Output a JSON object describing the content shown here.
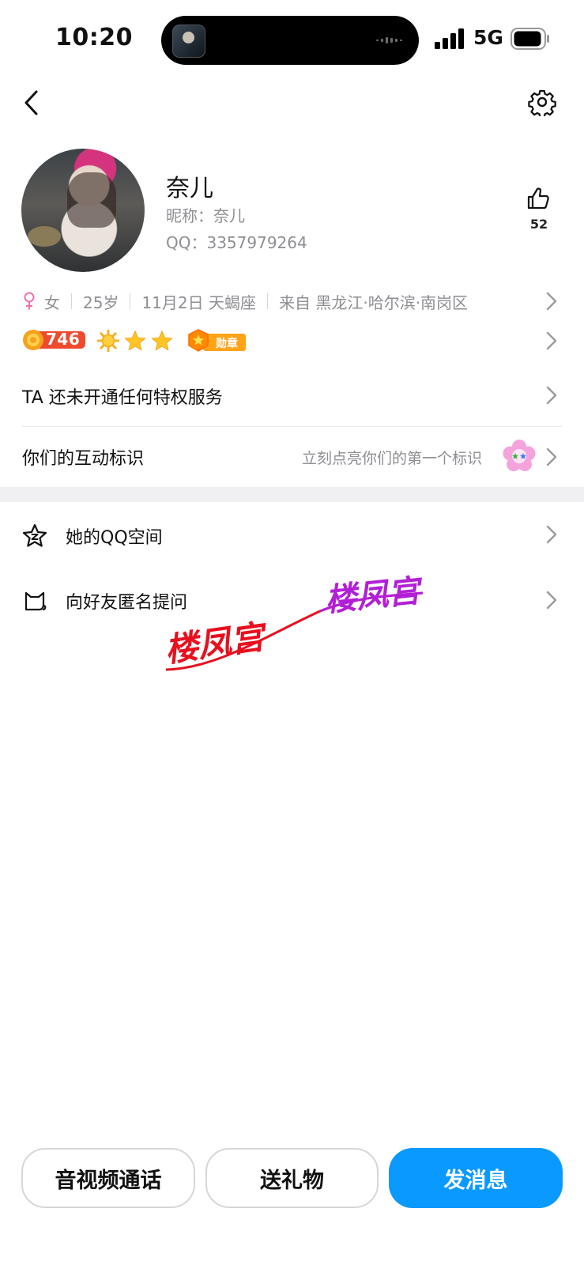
{
  "status_bar": {
    "time": "10:20",
    "network": "5G",
    "island_icon": "game-app-icon"
  },
  "header": {
    "back_icon": "chevron-left-icon",
    "settings_icon": "gear-icon"
  },
  "profile": {
    "name": "奈儿",
    "nickname_label": "昵称：",
    "nickname": "奈儿",
    "qq_label": "QQ：",
    "qq_number": "3357979264",
    "likes": "52"
  },
  "info": {
    "gender": "女",
    "age": "25岁",
    "birthday": "11月2日 天蝎座",
    "location": "来自 黑龙江·哈尔滨·南岗区",
    "gender_color": "#f36fae"
  },
  "level": {
    "level_value": "746",
    "medal_label": "勋章",
    "stars": 2
  },
  "rows": {
    "privilege": "TA 还未开通任何特权服务",
    "interaction": "你们的互动标识",
    "interaction_hint": "立刻点亮你们的第一个标识",
    "qzone": "她的QQ空间",
    "anon_question": "向好友匿名提问"
  },
  "watermark": {
    "left_text": "楼凤宫",
    "right_text": "楼凤宫"
  },
  "actions": {
    "call": "音视频通话",
    "gift": "送礼物",
    "message": "发消息",
    "accent": "#0a99ff"
  }
}
